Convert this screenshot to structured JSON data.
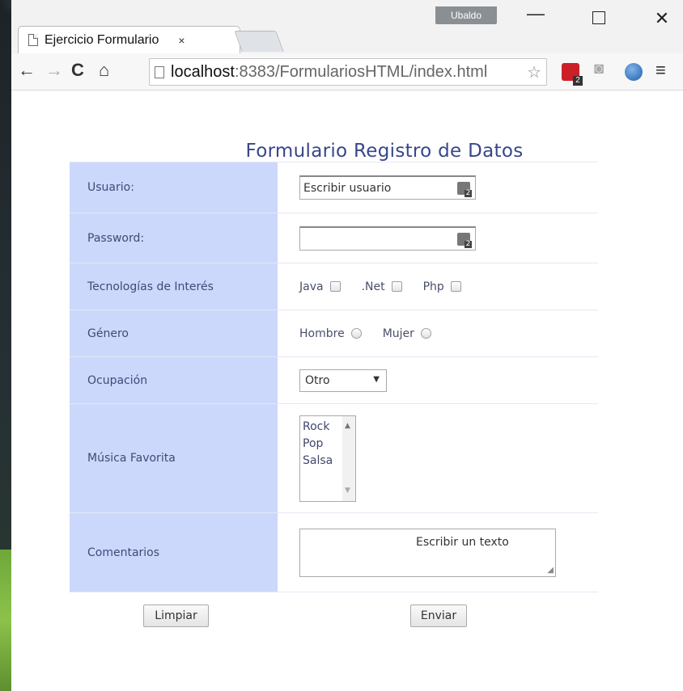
{
  "browser": {
    "tab_title": "Ejercicio Formulario",
    "tab_close": "×",
    "user_badge": "Ubaldo",
    "window_controls": {
      "minimize": "—",
      "close": "✕"
    },
    "nav": {
      "back": "←",
      "forward": "→",
      "reload": "C",
      "home": "⌂"
    },
    "url_host": "localhost",
    "url_rest": ":8383/FormulariosHTML/index.html",
    "bookmark_star": "☆",
    "extensions": {
      "lastpass_badge": "2",
      "camera": "◙",
      "menu": "≡"
    }
  },
  "form": {
    "title": "Formulario Registro de Datos",
    "usuario": {
      "label": "Usuario:",
      "placeholder": "Escribir usuario"
    },
    "password": {
      "label": "Password:",
      "value": ""
    },
    "tecnologias": {
      "label": "Tecnologías de Interés",
      "options": [
        "Java",
        ".Net",
        "Php"
      ]
    },
    "genero": {
      "label": "Género",
      "options": [
        "Hombre",
        "Mujer"
      ]
    },
    "ocupacion": {
      "label": "Ocupación",
      "selected": "Otro"
    },
    "musica": {
      "label": "Música Favorita",
      "options": [
        "Rock",
        "Pop",
        "Salsa"
      ]
    },
    "comentarios": {
      "label": "Comentarios",
      "placeholder": "Escribir un texto"
    },
    "buttons": {
      "clear": "Limpiar",
      "submit": "Enviar"
    }
  },
  "colors": {
    "label_bg": "#ccd8fb",
    "title": "#37478a",
    "label_text": "#3f4a78"
  }
}
